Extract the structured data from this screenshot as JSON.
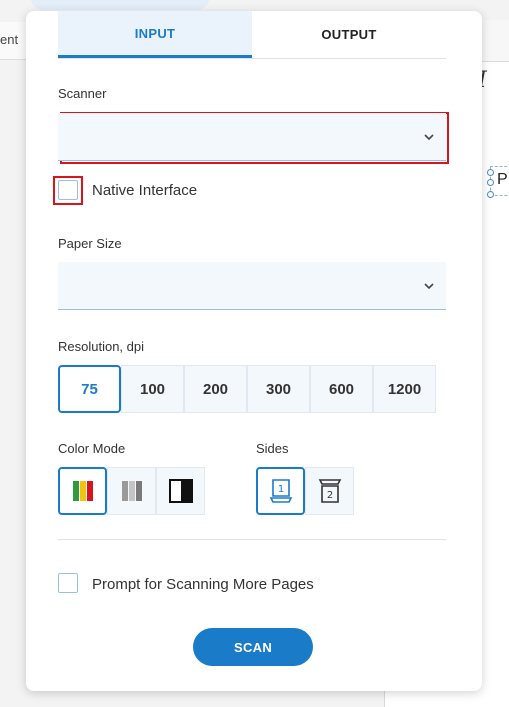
{
  "background": {
    "partial_text": "ent",
    "italic_glyph": "I",
    "p_letter": "P"
  },
  "tabs": [
    {
      "label": "INPUT",
      "active": true
    },
    {
      "label": "OUTPUT",
      "active": false
    }
  ],
  "scanner": {
    "label": "Scanner",
    "value": "",
    "chevron": "chevron-down-icon"
  },
  "native_interface": {
    "label": "Native Interface",
    "checked": false
  },
  "paper_size": {
    "label": "Paper Size",
    "value": "",
    "chevron": "chevron-down-icon"
  },
  "resolution": {
    "label": "Resolution, dpi",
    "options": [
      "75",
      "100",
      "200",
      "300",
      "600",
      "1200"
    ],
    "selected": "75"
  },
  "color_mode": {
    "label": "Color Mode",
    "options": [
      "color-icon",
      "grayscale-icon",
      "black-white-icon"
    ],
    "selected": "color-icon"
  },
  "sides": {
    "label": "Sides",
    "options": [
      "single-sided-icon",
      "double-sided-icon"
    ],
    "selected": "single-sided-icon"
  },
  "prompt_more_pages": {
    "label": "Prompt for Scanning More Pages",
    "checked": false
  },
  "scan_button": {
    "label": "SCAN"
  },
  "colors": {
    "accent": "#1a7bc9",
    "highlight": "#d9141d",
    "field_bg": "#f3f8fd"
  }
}
